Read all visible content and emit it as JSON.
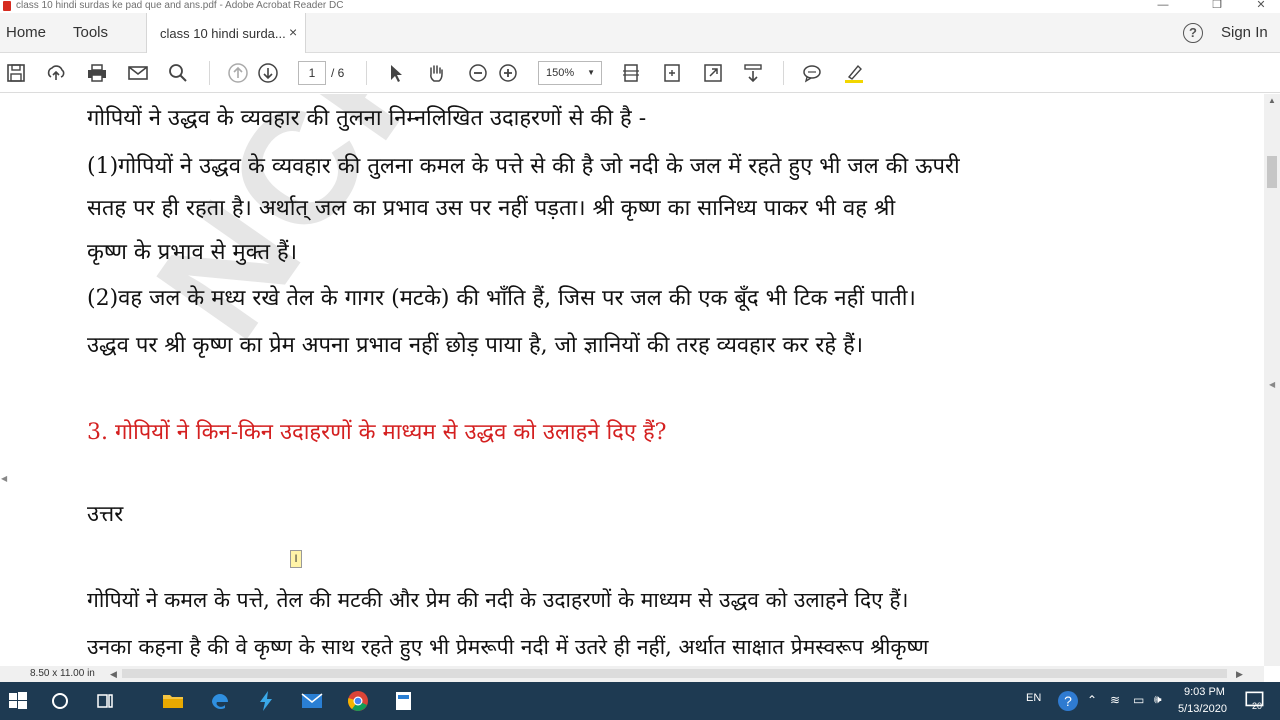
{
  "window": {
    "title": "class 10 hindi surdas ke pad que and ans.pdf - Adobe Acrobat Reader DC",
    "minimize": "—",
    "restore": "❐",
    "close": "✕"
  },
  "menubar": {
    "home": "Home",
    "tools": "Tools",
    "tab_label": "class 10 hindi surda...",
    "tab_close": "×",
    "help_icon": "?",
    "sign_in": "Sign In"
  },
  "toolbar": {
    "page_current": "1",
    "page_total": "/ 6",
    "zoom": "150%",
    "zoom_caret": "▼",
    "icons": [
      "save-icon",
      "upload-icon",
      "print-icon",
      "email-icon",
      "search-icon",
      "prev-page-icon",
      "next-page-icon",
      "select-cursor-icon",
      "hand-icon",
      "zoom-out-icon",
      "zoom-in-icon",
      "fit-page-icon",
      "full-screen-icon",
      "expand-icon",
      "scroll-mode-icon",
      "comment-icon",
      "highlight-icon"
    ]
  },
  "document": {
    "watermark": "NCRTSOL",
    "lines": [
      "गोपियों ने उद्धव के व्यवहार की तुलना निम्नलिखित उदाहरणों से की है -",
      "(1)गोपियों ने उद्धव के व्यवहार की तुलना कमल के पत्ते से की है जो नदी के जल में रहते हुए भी जल की ऊपरी",
      "सतह पर ही रहता है। अर्थात् जल का प्रभाव उस पर नहीं पड़ता। श्री कृष्ण का सानिध्य पाकर भी वह श्री",
      "कृष्ण  के प्रभाव से मुक्त हैं।",
      "(2)वह जल के मध्य रखे तेल के गागर (मटके) की भाँति हैं, जिस पर जल की एक बूँद भी टिक नहीं पाती।",
      "उद्धव पर श्री कृष्ण का प्रेम अपना प्रभाव नहीं छोड़ पाया है, जो ज्ञानियों की तरह व्यवहार कर रहे हैं।"
    ],
    "question": "3. गोपियों ने किन-किन उदाहरणों के माध्यम से उद्धव को उलाहने दिए हैं?",
    "answer_label": "उत्तर",
    "answer_lines": [
      "गोपियों ने कमल के पत्ते, तेल की मटकी और प्रेम की नदी के उदाहरणों के माध्यम से उद्धव को उलाहने दिए हैं।",
      "उनका कहना है की वे कृष्ण के साथ रहते हुए भी प्रेमरूपी नदी में उतरे ही नहीं, अर्थात साक्षात प्रेमस्वरूप श्रीकृष्ण"
    ],
    "cursor_glyph": "I"
  },
  "statusbar": {
    "page_size": "8.50 x 11.00 in",
    "left_arrow": "◀",
    "right_arrow": "▶"
  },
  "taskbar": {
    "language": "EN",
    "time": "9:03 PM",
    "date": "5/13/2020",
    "notifications": "20",
    "apps": [
      "start-icon",
      "cortana-icon",
      "task-view-icon",
      "file-explorer-icon",
      "edge-icon",
      "spark-icon",
      "mail-icon",
      "chrome-icon",
      "acrobat-icon"
    ]
  },
  "colors": {
    "question_red": "#d42020",
    "taskbar_bg": "#1e3a52",
    "acrobat_red": "#d62b20"
  }
}
